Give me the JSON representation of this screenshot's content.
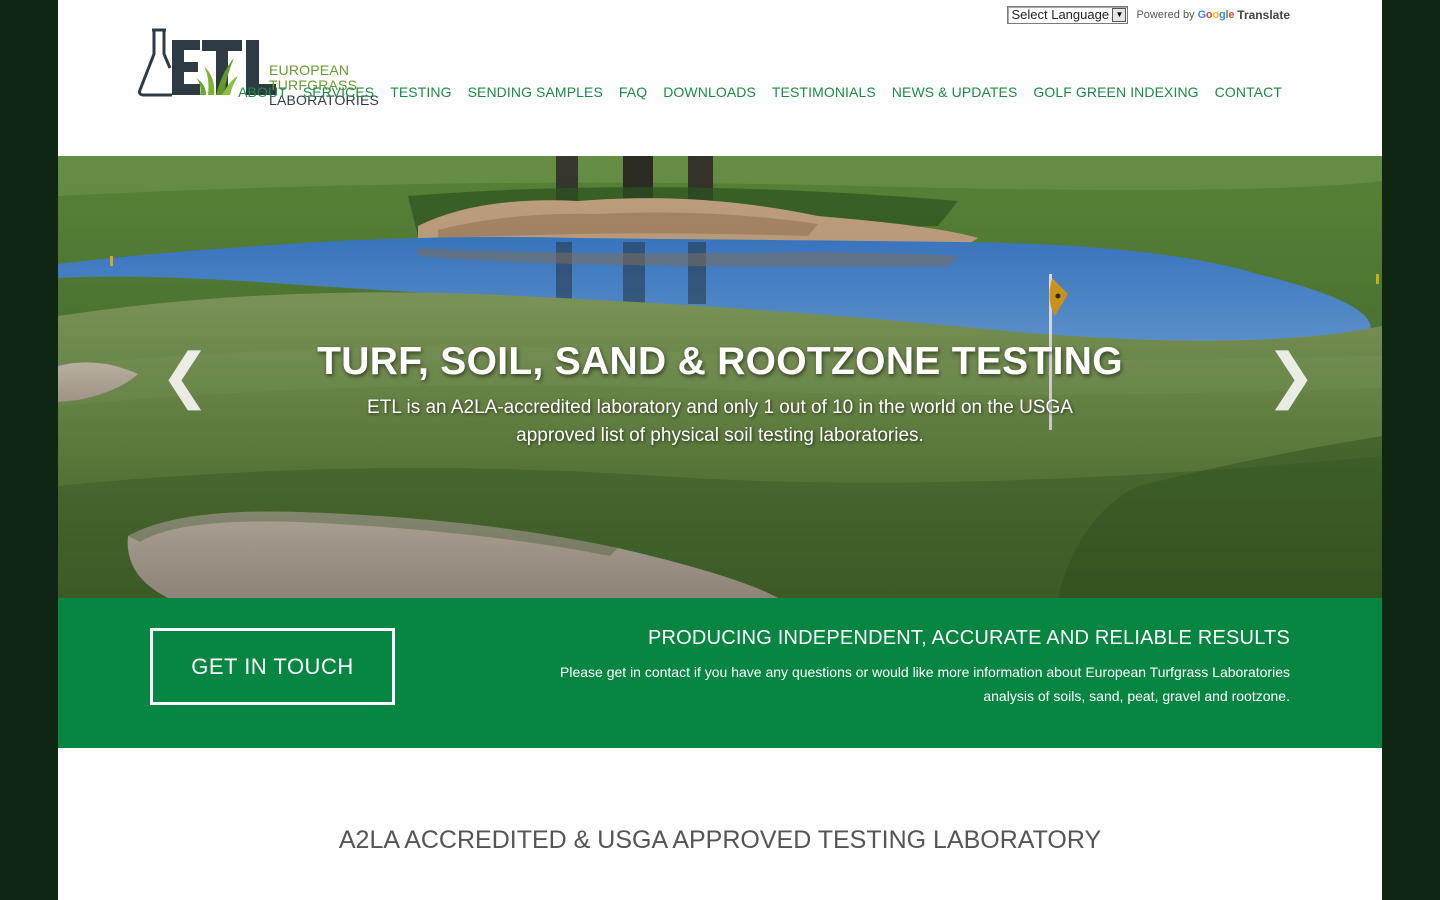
{
  "translate": {
    "select_label": "Select Language",
    "powered_by": "Powered by",
    "google": "Google",
    "translate": "Translate"
  },
  "logo": {
    "letters": "ETL",
    "line1": "EUROPEAN",
    "line2": "TURFGRASS",
    "line3": "LABORATORIES"
  },
  "nav": {
    "items": [
      "ABOUT",
      "SERVICES",
      "TESTING",
      "SENDING SAMPLES",
      "FAQ",
      "DOWNLOADS",
      "TESTIMONIALS",
      "NEWS & UPDATES",
      "GOLF GREEN INDEXING",
      "CONTACT"
    ]
  },
  "hero": {
    "title": "TURF, SOIL, SAND & ROOTZONE TESTING",
    "subtitle": "ETL is an A2LA-accredited laboratory and only 1 out of 10 in the world on the USGA approved list of physical soil testing laboratories.",
    "prev": "❮",
    "next": "❯"
  },
  "band": {
    "cta_label": "GET IN TOUCH",
    "title": "PRODUCING INDEPENDENT, ACCURATE AND RELIABLE RESULTS",
    "text": "Please get in contact if you have any questions or would like more information about European Turfgrass Laboratories analysis of soils, sand, peat, gravel and rootzone."
  },
  "section": {
    "title": "A2LA ACCREDITED & USGA APPROVED TESTING LABORATORY"
  },
  "colors": {
    "nav_green": "#1c8a44",
    "band_green": "#068641",
    "logo_dark": "#2f3b44",
    "logo_green": "#6a9a2c",
    "outer_bg": "#0f2614"
  }
}
